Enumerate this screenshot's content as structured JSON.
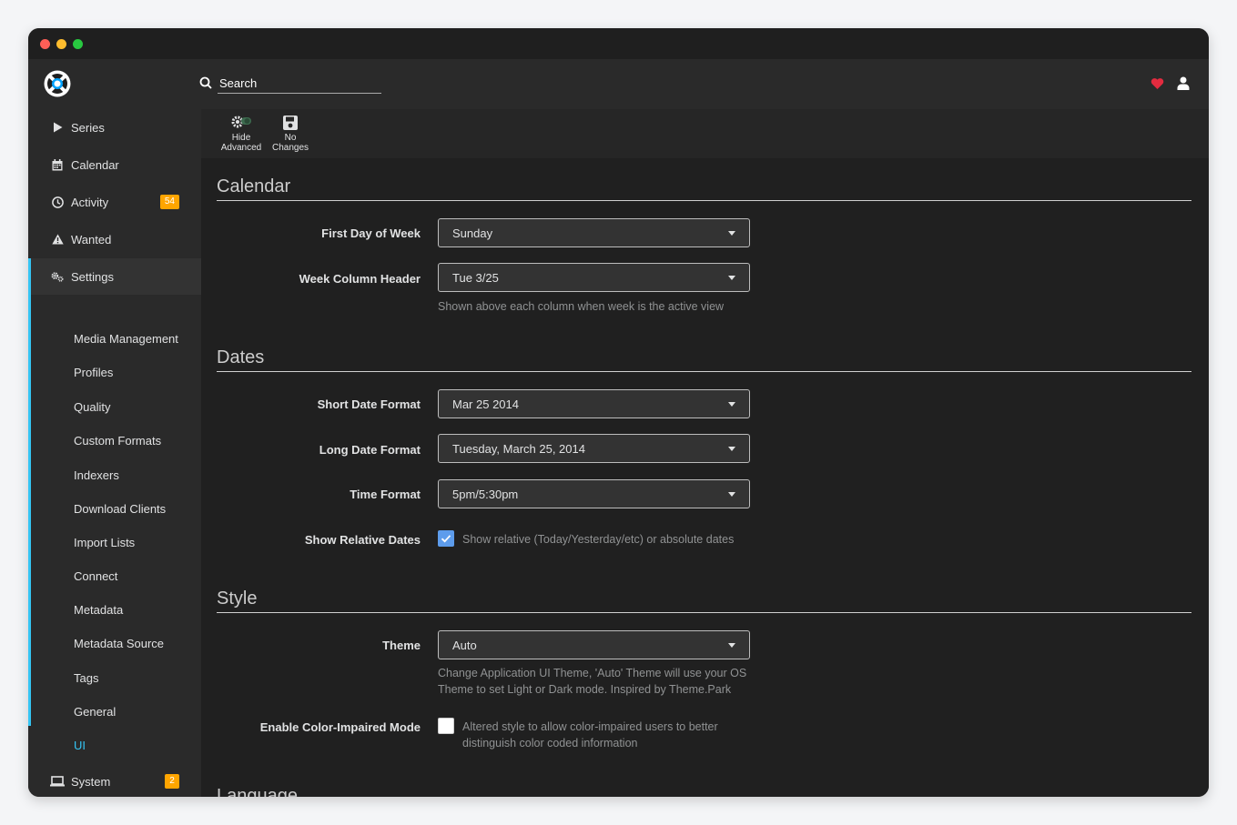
{
  "header": {
    "search_placeholder": "Search"
  },
  "sidebar": {
    "items": [
      {
        "label": "Series",
        "icon": "play-icon"
      },
      {
        "label": "Calendar",
        "icon": "calendar-icon"
      },
      {
        "label": "Activity",
        "icon": "clock-icon",
        "badge": "54"
      },
      {
        "label": "Wanted",
        "icon": "warning-icon"
      },
      {
        "label": "Settings",
        "icon": "cogs-icon"
      },
      {
        "label": "System",
        "icon": "laptop-icon",
        "badge": "2"
      }
    ],
    "settings_children": [
      "Media Management",
      "Profiles",
      "Quality",
      "Custom Formats",
      "Indexers",
      "Download Clients",
      "Import Lists",
      "Connect",
      "Metadata",
      "Metadata Source",
      "Tags",
      "General",
      "UI"
    ],
    "current_child": "UI"
  },
  "toolbar": {
    "hide_advanced": [
      "Hide",
      "Advanced"
    ],
    "no_changes": [
      "No",
      "Changes"
    ]
  },
  "sections": {
    "calendar": {
      "title": "Calendar",
      "first_day_label": "First Day of Week",
      "first_day_value": "Sunday",
      "week_header_label": "Week Column Header",
      "week_header_value": "Tue 3/25",
      "week_header_help": "Shown above each column when week is the active view"
    },
    "dates": {
      "title": "Dates",
      "short_label": "Short Date Format",
      "short_value": "Mar 25 2014",
      "long_label": "Long Date Format",
      "long_value": "Tuesday, March 25, 2014",
      "time_label": "Time Format",
      "time_value": "5pm/5:30pm",
      "relative_label": "Show Relative Dates",
      "relative_checked": true,
      "relative_help": "Show relative (Today/Yesterday/etc) or absolute dates"
    },
    "style": {
      "title": "Style",
      "theme_label": "Theme",
      "theme_value": "Auto",
      "theme_help": "Change Application UI Theme, 'Auto' Theme will use your OS Theme to set Light or Dark mode. Inspired by Theme.Park",
      "color_label": "Enable Color-Impaired Mode",
      "color_checked": false,
      "color_help": "Altered style to allow color-impaired users to better distinguish color coded information"
    },
    "language": {
      "title": "Language"
    }
  },
  "colors": {
    "accent": "#35c5f4",
    "badge": "#ffa500",
    "checkbox_on": "#5d9cec",
    "heart": "#e22b3f"
  }
}
